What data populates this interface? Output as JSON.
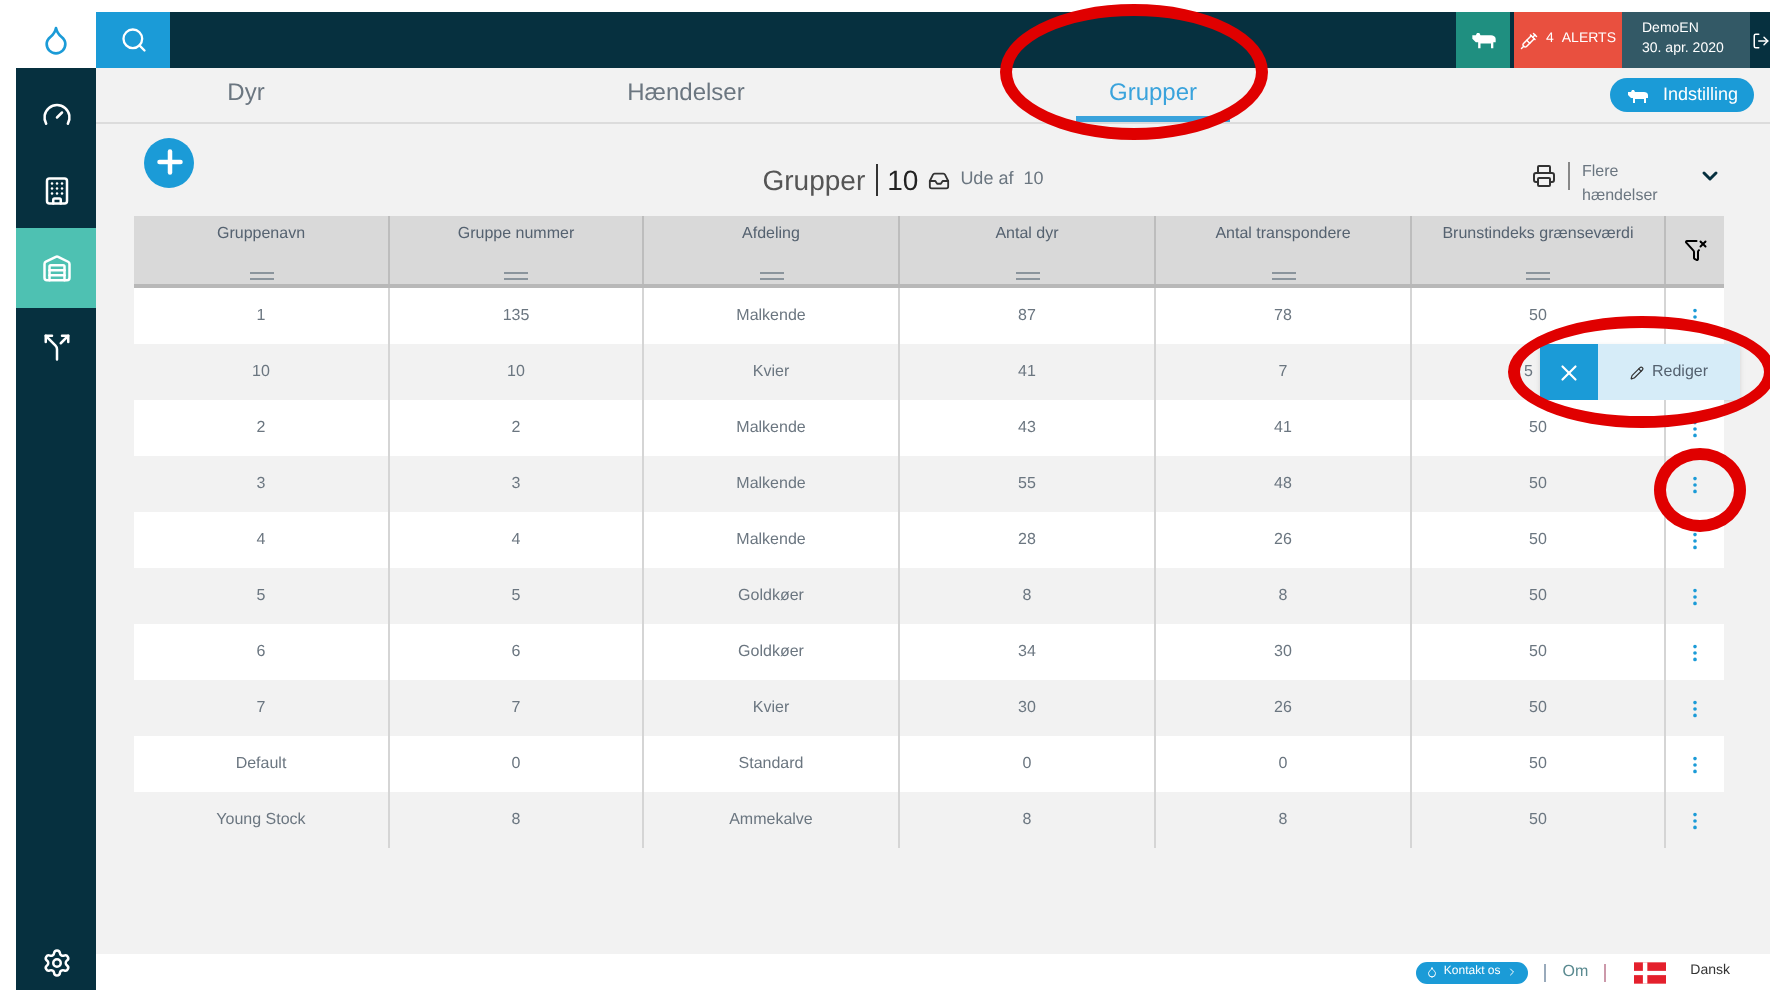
{
  "topbar": {
    "alerts": {
      "count": "4",
      "label": "ALERTS"
    },
    "user": {
      "name": "DemoEN",
      "date": "30. apr. 2020"
    }
  },
  "sidebar": {
    "items": [
      {
        "kind": "dashboard",
        "selected": false
      },
      {
        "kind": "reports",
        "selected": false
      },
      {
        "kind": "barn",
        "selected": true
      },
      {
        "kind": "routing",
        "selected": false
      }
    ]
  },
  "tabs": [
    {
      "label": "Dyr",
      "selected": false
    },
    {
      "label": "Hændelser",
      "selected": false
    },
    {
      "label": "Grupper",
      "selected": true
    }
  ],
  "settings_button": "Indstilling",
  "title": {
    "label": "Grupper",
    "count": "10",
    "out_label": "Ude af",
    "out_count": "10"
  },
  "more_events": "Flere hændelser",
  "table": {
    "columns": [
      "Gruppenavn",
      "Gruppe nummer",
      "Afdeling",
      "Antal dyr",
      "Antal transpondere",
      "Brunstindeks grænseværdi"
    ],
    "rows": [
      {
        "cells": [
          "1",
          "135",
          "Malkende",
          "87",
          "78",
          "50"
        ],
        "menu_open": false
      },
      {
        "cells": [
          "10",
          "10",
          "Kvier",
          "41",
          "7",
          "5"
        ],
        "menu_open": true
      },
      {
        "cells": [
          "2",
          "2",
          "Malkende",
          "43",
          "41",
          "50"
        ],
        "menu_open": false
      },
      {
        "cells": [
          "3",
          "3",
          "Malkende",
          "55",
          "48",
          "50"
        ],
        "menu_open": false
      },
      {
        "cells": [
          "4",
          "4",
          "Malkende",
          "28",
          "26",
          "50"
        ],
        "menu_open": false
      },
      {
        "cells": [
          "5",
          "5",
          "Goldkøer",
          "8",
          "8",
          "50"
        ],
        "menu_open": false
      },
      {
        "cells": [
          "6",
          "6",
          "Goldkøer",
          "34",
          "30",
          "50"
        ],
        "menu_open": false
      },
      {
        "cells": [
          "7",
          "7",
          "Kvier",
          "30",
          "26",
          "50"
        ],
        "menu_open": false
      },
      {
        "cells": [
          "Default",
          "0",
          "Standard",
          "0",
          "0",
          "50"
        ],
        "menu_open": false
      },
      {
        "cells": [
          "Young Stock",
          "8",
          "Ammekalve",
          "8",
          "8",
          "50"
        ],
        "menu_open": false
      }
    ],
    "row_menu": {
      "action": "Rediger"
    }
  },
  "footer": {
    "contact": "Kontakt os",
    "about": "Om",
    "language": "Dansk"
  }
}
